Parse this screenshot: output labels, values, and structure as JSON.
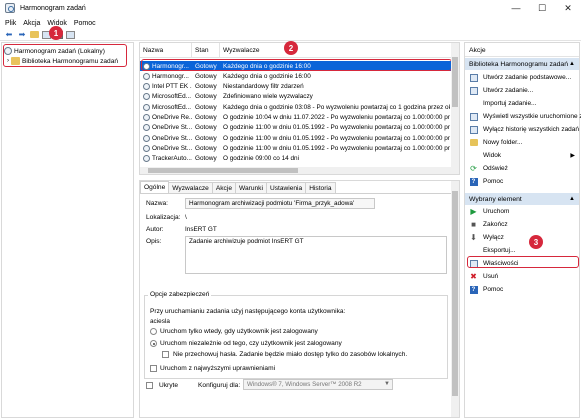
{
  "window": {
    "title": "Harmonogram zadań",
    "controls": {
      "minimize": "—",
      "maximize": "☐",
      "close": "✕"
    }
  },
  "menu": [
    "Plik",
    "Akcja",
    "Widok",
    "Pomoc"
  ],
  "toolbar": {
    "icons": [
      "back-arrow-icon",
      "forward-arrow-icon",
      "folder-up-icon",
      "properties-icon",
      "help-icon",
      "show-pane-icon"
    ]
  },
  "tree": {
    "root": "Harmonogram zadań (Lokalny)",
    "child": "Biblioteka Harmonogramu zadań"
  },
  "list": {
    "headers": [
      "Nazwa",
      "Stan",
      "Wyzwalacze"
    ],
    "rows": [
      {
        "name": "Harmonogr...",
        "status": "Gotowy",
        "trigger": "Każdego dnia o godzinie 16:00",
        "selected": true
      },
      {
        "name": "Harmonogr...",
        "status": "Gotowy",
        "trigger": "Każdego dnia o godzinie 16:00"
      },
      {
        "name": "Intel PTT EK ...",
        "status": "Gotowy",
        "trigger": "Niestandardowy filtr zdarzeń"
      },
      {
        "name": "MicrosoftEd...",
        "status": "Gotowy",
        "trigger": "Zdefiniowano wiele wyzwalaczy"
      },
      {
        "name": "MicrosoftEd...",
        "status": "Gotowy",
        "trigger": "Każdego dnia o godzinie 03:08 - Po wyzwoleniu powtarzaj co 1 godzina przez okr"
      },
      {
        "name": "OneDrive Re...",
        "status": "Gotowy",
        "trigger": "O godzinie 10:04 w dniu 11.07.2022 - Po wyzwoleniu powtarzaj co 1.00:00:00 przez"
      },
      {
        "name": "OneDrive St...",
        "status": "Gotowy",
        "trigger": "O godzinie 11:00 w dniu 01.05.1992 - Po wyzwoleniu powtarzaj co 1.00:00:00 przez"
      },
      {
        "name": "OneDrive St...",
        "status": "Gotowy",
        "trigger": "O godzinie 11:00 w dniu 01.05.1992 - Po wyzwoleniu powtarzaj co 1.00:00:00 przez"
      },
      {
        "name": "OneDrive St...",
        "status": "Gotowy",
        "trigger": "O godzinie 11:00 w dniu 01.05.1992 - Po wyzwoleniu powtarzaj co 1.00:00:00 przez"
      },
      {
        "name": "TrackerAuto...",
        "status": "Gotowy",
        "trigger": "O godzinie 09:00 co 14 dni"
      }
    ]
  },
  "details": {
    "tabs": [
      "Ogólne",
      "Wyzwalacze",
      "Akcje",
      "Warunki",
      "Ustawienia",
      "Historia"
    ],
    "labels": {
      "name": "Nazwa:",
      "location": "Lokalizacja:",
      "author": "Autor:",
      "description": "Opis:"
    },
    "values": {
      "name": "Harmonogram archiwizacji podmiotu 'Firma_przyk_adowa'",
      "location": "\\",
      "author": "InsERT GT",
      "description": "Zadanie archiwizuje podmiot InsERT GT"
    },
    "security": {
      "title": "Opcje zabezpieczeń",
      "account_label": "Przy uruchamianiu zadania użyj następującego konta użytkownika:",
      "account": "aciesla",
      "radio_logged_on": "Uruchom tylko wtedy, gdy użytkownik jest zalogowany",
      "radio_any": "Uruchom niezależnie od tego, czy użytkownik jest zalogowany",
      "no_password": "Nie przechowuj hasła. Zadanie będzie miało dostęp tylko do zasobów lokalnych.",
      "highest": "Uruchom z najwyższymi uprawnieniami"
    },
    "hidden_label": "Ukryte",
    "configure_label": "Konfiguruj dla:",
    "configure_value": "Windows® 7, Windows Server™ 2008 R2"
  },
  "actions": {
    "header": "Akcje",
    "library_section": "Biblioteka Harmonogramu zadań",
    "library_items": [
      {
        "label": "Utwórz zadanie podstawowe...",
        "icon": "create-basic-task-icon"
      },
      {
        "label": "Utwórz zadanie...",
        "icon": "create-task-icon"
      },
      {
        "label": "Importuj zadanie...",
        "icon": ""
      },
      {
        "label": "Wyświetl wszystkie uruchomione zadania",
        "icon": "running-tasks-icon"
      },
      {
        "label": "Wyłącz historię wszystkich zadań",
        "icon": "history-icon"
      },
      {
        "label": "Nowy folder...",
        "icon": "new-folder-icon"
      },
      {
        "label": "Widok",
        "icon": "",
        "submenu": "▶"
      },
      {
        "label": "Odśwież",
        "icon": "refresh-icon"
      },
      {
        "label": "Pomoc",
        "icon": "help-icon"
      }
    ],
    "selected_section": "Wybrany element",
    "selected_items": [
      {
        "label": "Uruchom",
        "icon": "run-icon"
      },
      {
        "label": "Zakończ",
        "icon": "end-icon"
      },
      {
        "label": "Wyłącz",
        "icon": "disable-icon"
      },
      {
        "label": "Eksportuj...",
        "icon": ""
      },
      {
        "label": "Właściwości",
        "icon": "properties-icon"
      },
      {
        "label": "Usuń",
        "icon": "delete-icon"
      },
      {
        "label": "Pomoc",
        "icon": "help-icon"
      }
    ]
  },
  "annotations": {
    "badge1": "1",
    "badge2": "2",
    "badge3": "3",
    "highlight_color": "#d6283c"
  },
  "colors": {
    "selection": "#0a64d8",
    "section_header": "#d7e4f2"
  }
}
